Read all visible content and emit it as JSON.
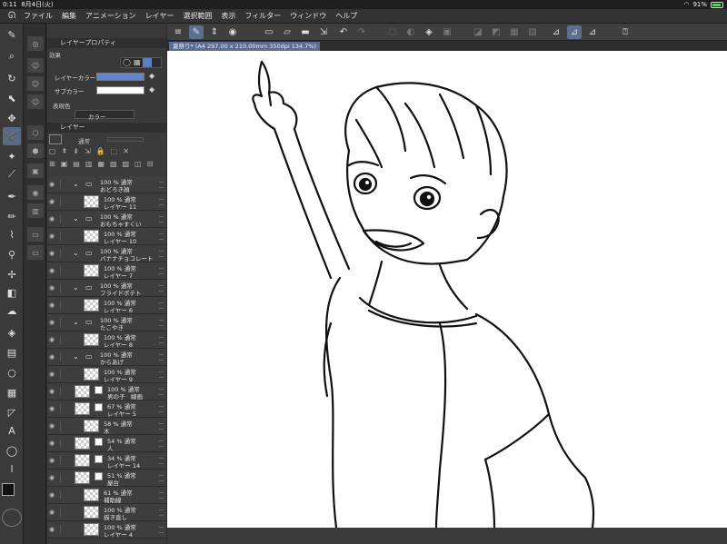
{
  "status": {
    "time": "0:11",
    "date": "8月4日(火)",
    "battery": "91%"
  },
  "menu": {
    "items": [
      "ファイル",
      "編集",
      "アニメーション",
      "レイヤー",
      "選択範囲",
      "表示",
      "フィルター",
      "ウィンドウ",
      "ヘルプ"
    ]
  },
  "props_panel": {
    "title": "レイヤープロパティ",
    "effect_label": "効果",
    "layer_color_label": "レイヤーカラー",
    "sub_color_label": "サブカラー",
    "express_color_label": "表現色",
    "express_color_value": "カラー",
    "layer_color": "#5b87d6",
    "sub_color": "#ffffff"
  },
  "layer_panel": {
    "title": "レイヤー",
    "blend_mode": "通常",
    "rows": [
      {
        "type": "folder",
        "l1": "100 % 通常",
        "l2": "おどろき顔"
      },
      {
        "type": "layer",
        "l1": "100 % 通常",
        "l2": "レイヤー 11"
      },
      {
        "type": "folder",
        "l1": "100 % 通常",
        "l2": "おもちゃすくい"
      },
      {
        "type": "layer",
        "l1": "100 % 通常",
        "l2": "レイヤー 10"
      },
      {
        "type": "folder",
        "l1": "100 % 通常",
        "l2": "バナナチョコレート"
      },
      {
        "type": "layer",
        "l1": "100 % 通常",
        "l2": "レイヤー 7"
      },
      {
        "type": "folder",
        "l1": "100 % 通常",
        "l2": "フライドポテト"
      },
      {
        "type": "layer",
        "l1": "100 % 通常",
        "l2": "レイヤー 6"
      },
      {
        "type": "folder",
        "l1": "100 % 通常",
        "l2": "たこやき"
      },
      {
        "type": "layer",
        "l1": "100 % 通常",
        "l2": "レイヤー 8"
      },
      {
        "type": "folder",
        "l1": "100 % 通常",
        "l2": "からあげ"
      },
      {
        "type": "layer",
        "l1": "100 % 通常",
        "l2": "レイヤー 9"
      },
      {
        "type": "layer-mask",
        "l1": "100 % 通常",
        "l2": "男の子　線画"
      },
      {
        "type": "layer-mask",
        "l1": "67 % 通常",
        "l2": "レイヤー 5"
      },
      {
        "type": "layer",
        "l1": "58 % 通常",
        "l2": "木"
      },
      {
        "type": "layer-mask",
        "l1": "54 % 通常",
        "l2": "人"
      },
      {
        "type": "layer-mask",
        "l1": "34 % 通常",
        "l2": "レイヤー 14"
      },
      {
        "type": "layer-mask",
        "l1": "51 % 通常",
        "l2": "屋台"
      },
      {
        "type": "layer",
        "l1": "61 % 通常",
        "l2": "補助線"
      },
      {
        "type": "layer",
        "l1": "100 % 通常",
        "l2": "描き直し"
      },
      {
        "type": "layer",
        "l1": "100 % 通常",
        "l2": "レイヤー 4"
      }
    ]
  },
  "document": {
    "tab_label": "夏祭り* (A4 297.00 x 210.00mm 350dpi 134.7%)"
  },
  "colors": {
    "main": "#111111",
    "sub": "#ffffff",
    "accent": "#5a6e91"
  }
}
